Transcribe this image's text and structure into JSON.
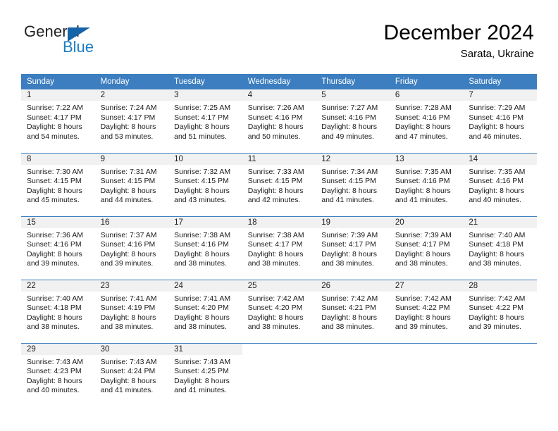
{
  "brand": {
    "name_part1": "General",
    "name_part2": "Blue",
    "triangle_color": "#1763a8",
    "blue_color": "#1c7cc4"
  },
  "header": {
    "title": "December 2024",
    "location": "Sarata, Ukraine"
  },
  "theme": {
    "header_blue": "#3c7ebf",
    "daynum_band": "#f1f1f1",
    "text": "#1a1a1a"
  },
  "weekday_headers": [
    "Sunday",
    "Monday",
    "Tuesday",
    "Wednesday",
    "Thursday",
    "Friday",
    "Saturday"
  ],
  "labels": {
    "sunrise_prefix": "Sunrise:",
    "sunset_prefix": "Sunset:",
    "daylight_prefix": "Daylight:"
  },
  "weeks": [
    [
      {
        "day": "1",
        "sunrise": "Sunrise: 7:22 AM",
        "sunset": "Sunset: 4:17 PM",
        "daylight_line1": "Daylight: 8 hours",
        "daylight_line2": "and 54 minutes."
      },
      {
        "day": "2",
        "sunrise": "Sunrise: 7:24 AM",
        "sunset": "Sunset: 4:17 PM",
        "daylight_line1": "Daylight: 8 hours",
        "daylight_line2": "and 53 minutes."
      },
      {
        "day": "3",
        "sunrise": "Sunrise: 7:25 AM",
        "sunset": "Sunset: 4:17 PM",
        "daylight_line1": "Daylight: 8 hours",
        "daylight_line2": "and 51 minutes."
      },
      {
        "day": "4",
        "sunrise": "Sunrise: 7:26 AM",
        "sunset": "Sunset: 4:16 PM",
        "daylight_line1": "Daylight: 8 hours",
        "daylight_line2": "and 50 minutes."
      },
      {
        "day": "5",
        "sunrise": "Sunrise: 7:27 AM",
        "sunset": "Sunset: 4:16 PM",
        "daylight_line1": "Daylight: 8 hours",
        "daylight_line2": "and 49 minutes."
      },
      {
        "day": "6",
        "sunrise": "Sunrise: 7:28 AM",
        "sunset": "Sunset: 4:16 PM",
        "daylight_line1": "Daylight: 8 hours",
        "daylight_line2": "and 47 minutes."
      },
      {
        "day": "7",
        "sunrise": "Sunrise: 7:29 AM",
        "sunset": "Sunset: 4:16 PM",
        "daylight_line1": "Daylight: 8 hours",
        "daylight_line2": "and 46 minutes."
      }
    ],
    [
      {
        "day": "8",
        "sunrise": "Sunrise: 7:30 AM",
        "sunset": "Sunset: 4:15 PM",
        "daylight_line1": "Daylight: 8 hours",
        "daylight_line2": "and 45 minutes."
      },
      {
        "day": "9",
        "sunrise": "Sunrise: 7:31 AM",
        "sunset": "Sunset: 4:15 PM",
        "daylight_line1": "Daylight: 8 hours",
        "daylight_line2": "and 44 minutes."
      },
      {
        "day": "10",
        "sunrise": "Sunrise: 7:32 AM",
        "sunset": "Sunset: 4:15 PM",
        "daylight_line1": "Daylight: 8 hours",
        "daylight_line2": "and 43 minutes."
      },
      {
        "day": "11",
        "sunrise": "Sunrise: 7:33 AM",
        "sunset": "Sunset: 4:15 PM",
        "daylight_line1": "Daylight: 8 hours",
        "daylight_line2": "and 42 minutes."
      },
      {
        "day": "12",
        "sunrise": "Sunrise: 7:34 AM",
        "sunset": "Sunset: 4:15 PM",
        "daylight_line1": "Daylight: 8 hours",
        "daylight_line2": "and 41 minutes."
      },
      {
        "day": "13",
        "sunrise": "Sunrise: 7:35 AM",
        "sunset": "Sunset: 4:16 PM",
        "daylight_line1": "Daylight: 8 hours",
        "daylight_line2": "and 41 minutes."
      },
      {
        "day": "14",
        "sunrise": "Sunrise: 7:35 AM",
        "sunset": "Sunset: 4:16 PM",
        "daylight_line1": "Daylight: 8 hours",
        "daylight_line2": "and 40 minutes."
      }
    ],
    [
      {
        "day": "15",
        "sunrise": "Sunrise: 7:36 AM",
        "sunset": "Sunset: 4:16 PM",
        "daylight_line1": "Daylight: 8 hours",
        "daylight_line2": "and 39 minutes."
      },
      {
        "day": "16",
        "sunrise": "Sunrise: 7:37 AM",
        "sunset": "Sunset: 4:16 PM",
        "daylight_line1": "Daylight: 8 hours",
        "daylight_line2": "and 39 minutes."
      },
      {
        "day": "17",
        "sunrise": "Sunrise: 7:38 AM",
        "sunset": "Sunset: 4:16 PM",
        "daylight_line1": "Daylight: 8 hours",
        "daylight_line2": "and 38 minutes."
      },
      {
        "day": "18",
        "sunrise": "Sunrise: 7:38 AM",
        "sunset": "Sunset: 4:17 PM",
        "daylight_line1": "Daylight: 8 hours",
        "daylight_line2": "and 38 minutes."
      },
      {
        "day": "19",
        "sunrise": "Sunrise: 7:39 AM",
        "sunset": "Sunset: 4:17 PM",
        "daylight_line1": "Daylight: 8 hours",
        "daylight_line2": "and 38 minutes."
      },
      {
        "day": "20",
        "sunrise": "Sunrise: 7:39 AM",
        "sunset": "Sunset: 4:17 PM",
        "daylight_line1": "Daylight: 8 hours",
        "daylight_line2": "and 38 minutes."
      },
      {
        "day": "21",
        "sunrise": "Sunrise: 7:40 AM",
        "sunset": "Sunset: 4:18 PM",
        "daylight_line1": "Daylight: 8 hours",
        "daylight_line2": "and 38 minutes."
      }
    ],
    [
      {
        "day": "22",
        "sunrise": "Sunrise: 7:40 AM",
        "sunset": "Sunset: 4:18 PM",
        "daylight_line1": "Daylight: 8 hours",
        "daylight_line2": "and 38 minutes."
      },
      {
        "day": "23",
        "sunrise": "Sunrise: 7:41 AM",
        "sunset": "Sunset: 4:19 PM",
        "daylight_line1": "Daylight: 8 hours",
        "daylight_line2": "and 38 minutes."
      },
      {
        "day": "24",
        "sunrise": "Sunrise: 7:41 AM",
        "sunset": "Sunset: 4:20 PM",
        "daylight_line1": "Daylight: 8 hours",
        "daylight_line2": "and 38 minutes."
      },
      {
        "day": "25",
        "sunrise": "Sunrise: 7:42 AM",
        "sunset": "Sunset: 4:20 PM",
        "daylight_line1": "Daylight: 8 hours",
        "daylight_line2": "and 38 minutes."
      },
      {
        "day": "26",
        "sunrise": "Sunrise: 7:42 AM",
        "sunset": "Sunset: 4:21 PM",
        "daylight_line1": "Daylight: 8 hours",
        "daylight_line2": "and 38 minutes."
      },
      {
        "day": "27",
        "sunrise": "Sunrise: 7:42 AM",
        "sunset": "Sunset: 4:22 PM",
        "daylight_line1": "Daylight: 8 hours",
        "daylight_line2": "and 39 minutes."
      },
      {
        "day": "28",
        "sunrise": "Sunrise: 7:42 AM",
        "sunset": "Sunset: 4:22 PM",
        "daylight_line1": "Daylight: 8 hours",
        "daylight_line2": "and 39 minutes."
      }
    ],
    [
      {
        "day": "29",
        "sunrise": "Sunrise: 7:43 AM",
        "sunset": "Sunset: 4:23 PM",
        "daylight_line1": "Daylight: 8 hours",
        "daylight_line2": "and 40 minutes."
      },
      {
        "day": "30",
        "sunrise": "Sunrise: 7:43 AM",
        "sunset": "Sunset: 4:24 PM",
        "daylight_line1": "Daylight: 8 hours",
        "daylight_line2": "and 41 minutes."
      },
      {
        "day": "31",
        "sunrise": "Sunrise: 7:43 AM",
        "sunset": "Sunset: 4:25 PM",
        "daylight_line1": "Daylight: 8 hours",
        "daylight_line2": "and 41 minutes."
      },
      {
        "day": "",
        "sunrise": "",
        "sunset": "",
        "daylight_line1": "",
        "daylight_line2": ""
      },
      {
        "day": "",
        "sunrise": "",
        "sunset": "",
        "daylight_line1": "",
        "daylight_line2": ""
      },
      {
        "day": "",
        "sunrise": "",
        "sunset": "",
        "daylight_line1": "",
        "daylight_line2": ""
      },
      {
        "day": "",
        "sunrise": "",
        "sunset": "",
        "daylight_line1": "",
        "daylight_line2": ""
      }
    ]
  ]
}
